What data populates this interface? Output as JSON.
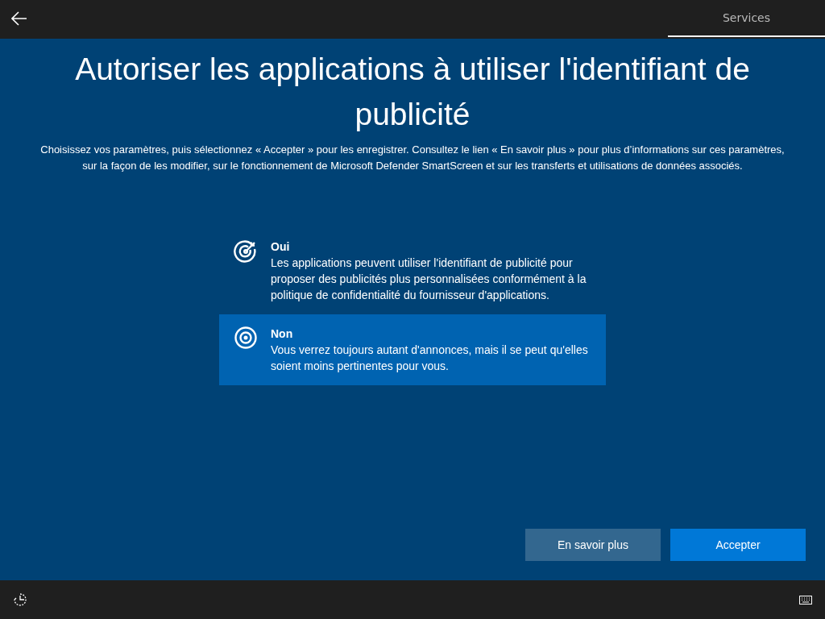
{
  "top_bar": {
    "tabs": [
      {
        "label": "Services",
        "selected": true
      }
    ]
  },
  "title": "Autoriser les applications à utiliser l'identifiant de publicité",
  "description": "Choisissez vos paramètres, puis sélectionnez « Accepter » pour les enregistrer. Consultez le lien « En savoir plus » pour plus d’informations sur ces paramètres, sur la façon de les modifier, sur le fonctionnement de Microsoft Defender SmartScreen et sur les transferts et utilisations de données associés.",
  "options": [
    {
      "kind": "target-arrow",
      "label": "Oui",
      "text": "Les applications peuvent utiliser l'identifiant de publicité pour proposer des publicités plus personnalisées conformément à la politique de confidentialité du fournisseur d'applications.",
      "selected": false
    },
    {
      "kind": "target",
      "label": "Non",
      "text": "Vous verrez toujours autant d'annonces, mais il se peut qu'elles soient moins pertinentes pour vous.",
      "selected": true
    }
  ],
  "buttons": [
    {
      "label": "En savoir plus",
      "kind": "secondary"
    },
    {
      "label": "Accepter",
      "kind": "primary"
    }
  ]
}
